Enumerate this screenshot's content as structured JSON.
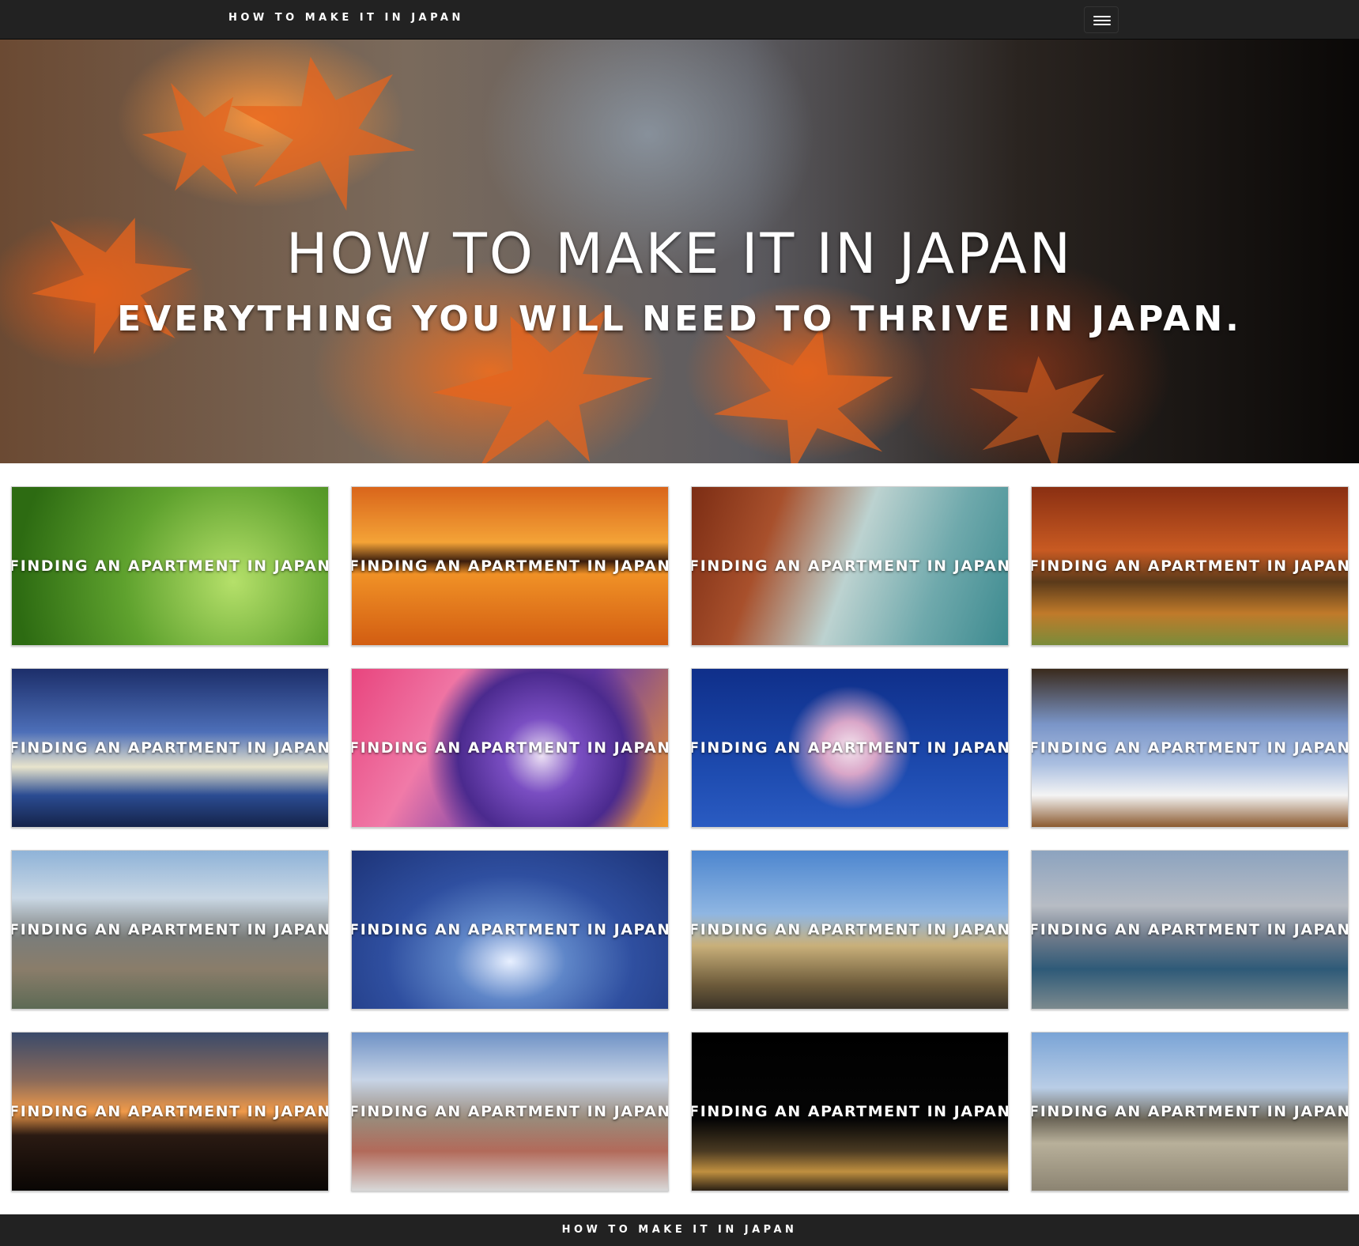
{
  "navbar": {
    "brand": "HOW TO MAKE IT IN JAPAN",
    "menu_icon": "hamburger-menu-icon"
  },
  "hero": {
    "title": "HOW TO MAKE IT IN JAPAN",
    "subtitle": "EVERYTHING YOU WILL NEED TO THRIVE IN JAPAN."
  },
  "cards": [
    {
      "label": "FINDING AN APARTMENT IN JAPAN"
    },
    {
      "label": "FINDING AN APARTMENT IN JAPAN"
    },
    {
      "label": "FINDING AN APARTMENT IN JAPAN"
    },
    {
      "label": "FINDING AN APARTMENT IN JAPAN"
    },
    {
      "label": "FINDING AN APARTMENT IN JAPAN"
    },
    {
      "label": "FINDING AN APARTMENT IN JAPAN"
    },
    {
      "label": "FINDING AN APARTMENT IN JAPAN"
    },
    {
      "label": "FINDING AN APARTMENT IN JAPAN"
    },
    {
      "label": "FINDING AN APARTMENT IN JAPAN"
    },
    {
      "label": "FINDING AN APARTMENT IN JAPAN"
    },
    {
      "label": "FINDING AN APARTMENT IN JAPAN"
    },
    {
      "label": "FINDING AN APARTMENT IN JAPAN"
    },
    {
      "label": "FINDING AN APARTMENT IN JAPAN"
    },
    {
      "label": "FINDING AN APARTMENT IN JAPAN"
    },
    {
      "label": "FINDING AN APARTMENT IN JAPAN"
    },
    {
      "label": "FINDING AN APARTMENT IN JAPAN"
    }
  ],
  "footer": {
    "text": "HOW TO MAKE IT IN JAPAN"
  },
  "colors": {
    "navbar_bg": "#222222",
    "footer_bg": "#222222",
    "text_light": "#ffffff"
  }
}
